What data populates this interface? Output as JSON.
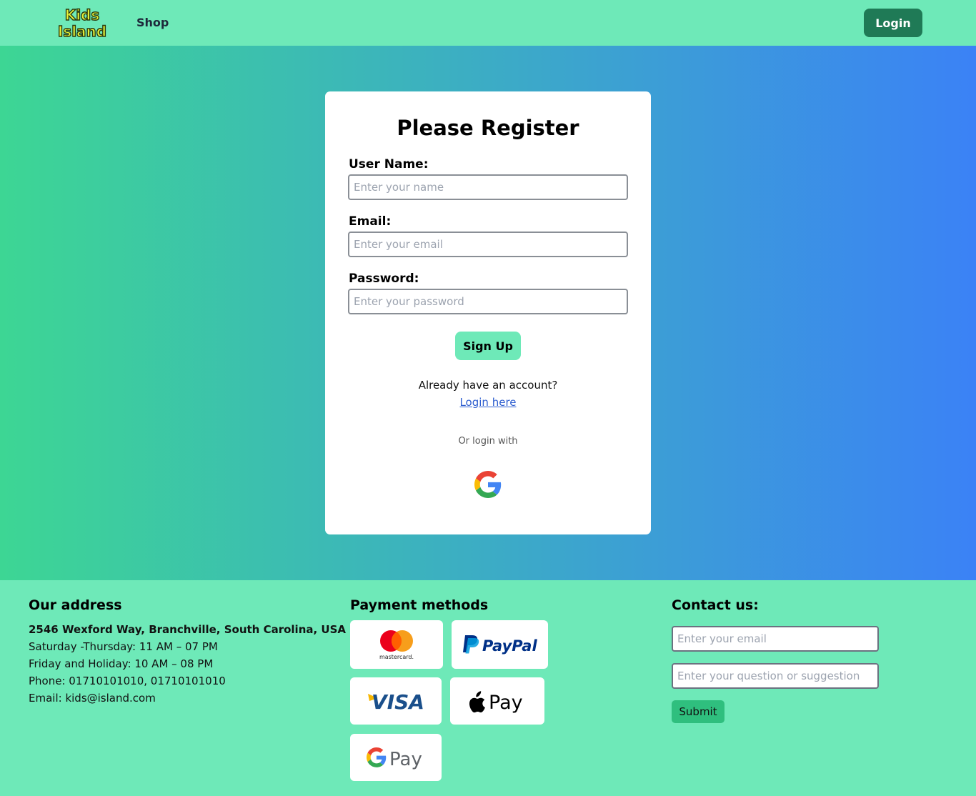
{
  "navbar": {
    "logo_text_line1": "Kids",
    "logo_text_line2": "Island",
    "shop_label": "Shop",
    "login_label": "Login"
  },
  "register": {
    "title": "Please Register",
    "username_label": "User Name:",
    "username_placeholder": "Enter your name",
    "email_label": "Email:",
    "email_placeholder": "Enter your email",
    "password_label": "Password:",
    "password_placeholder": "Enter your password",
    "signup_label": "Sign Up",
    "already_text": "Already have an account?",
    "login_link": "Login here",
    "or_login_text": "Or login with",
    "google_icon": "google-icon"
  },
  "footer": {
    "address": {
      "heading": "Our address",
      "street": "2546 Wexford Way, Branchville, South Carolina, USA",
      "hours_weekday": "Saturday -Thursday: 11 AM – 07 PM",
      "hours_holiday": "Friday and Holiday: 10 AM – 08 PM",
      "phone": "Phone: 01710101010, 01710101010",
      "email": "Email: kids@island.com"
    },
    "payment": {
      "heading": "Payment methods",
      "methods": {
        "mastercard": "mastercard.",
        "paypal": "PayPal",
        "visa": "VISA",
        "applepay": "Pay",
        "gpay": "Pay"
      }
    },
    "contact": {
      "heading": "Contact us:",
      "email_placeholder": "Enter your email",
      "question_placeholder": "Enter your question or suggestion",
      "submit_label": "Submit"
    }
  },
  "colors": {
    "nav_bg": "#6ee9b8",
    "login_btn": "#1f7a56",
    "gradient_start": "#3dd694",
    "gradient_end": "#3b82f6",
    "link": "#2f5fd0"
  }
}
